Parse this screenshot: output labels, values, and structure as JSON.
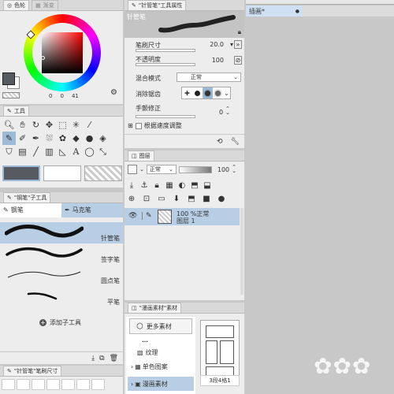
{
  "color_panel": {
    "tab_color_wheel": "色轮",
    "tab_gradient": "渐变",
    "readout_h": "0",
    "readout_s": "0",
    "readout_v": "41"
  },
  "tool_panel": {
    "tab_label": "工具"
  },
  "subtool_panel": {
    "tab_label": "\"钢笔\"子工具",
    "tab_pen": "钢笔",
    "tab_marker": "马克笔",
    "brushes": [
      {
        "name": "针管笔",
        "selected": true
      },
      {
        "name": "签字笔",
        "selected": false
      },
      {
        "name": "圆点笔",
        "selected": false
      },
      {
        "name": "平笔",
        "selected": false
      }
    ],
    "add_subtool_label": "添加子工具"
  },
  "brush_size_panel": {
    "tab_label": "\"针管笔\"笔刷尺寸"
  },
  "property_panel": {
    "tab_label": "\"针管笔\"工具属性",
    "tool_name": "针管笔",
    "brush_size_label": "笔刷尺寸",
    "brush_size_value": "20.0",
    "opacity_label": "不透明度",
    "opacity_value": "100",
    "blend_mode_label": "混合模式",
    "blend_mode_value": "正常",
    "antialias_label": "消除锯齿",
    "stabilization_label": "手颤修正",
    "stabilization_value": "0",
    "speed_adjust_label": "根据速度调整"
  },
  "layer_panel": {
    "tab_label": "图层",
    "blend_mode_value": "正常",
    "opacity_value": "100",
    "layers": [
      {
        "line1": "100 %正常",
        "line2": "图层 1"
      }
    ]
  },
  "material_panel": {
    "tab_label": "\"漫画素材\"素材",
    "more_materials_label": "更多素材",
    "cut_label": "...",
    "tree": [
      {
        "label": "纹理",
        "expandable": false
      },
      {
        "label": "单色图案",
        "expandable": true
      },
      {
        "label": "漫画素材",
        "expandable": true,
        "selected": true
      }
    ],
    "thumbnail_caption": "3段4格1"
  },
  "canvas": {
    "tab_label": "插画*"
  },
  "colors": {
    "accent": "#9dbad6",
    "selected_row": "#b8cee4",
    "panel_bg": "#ededed",
    "canvas_bg": "#c8c8c8"
  }
}
